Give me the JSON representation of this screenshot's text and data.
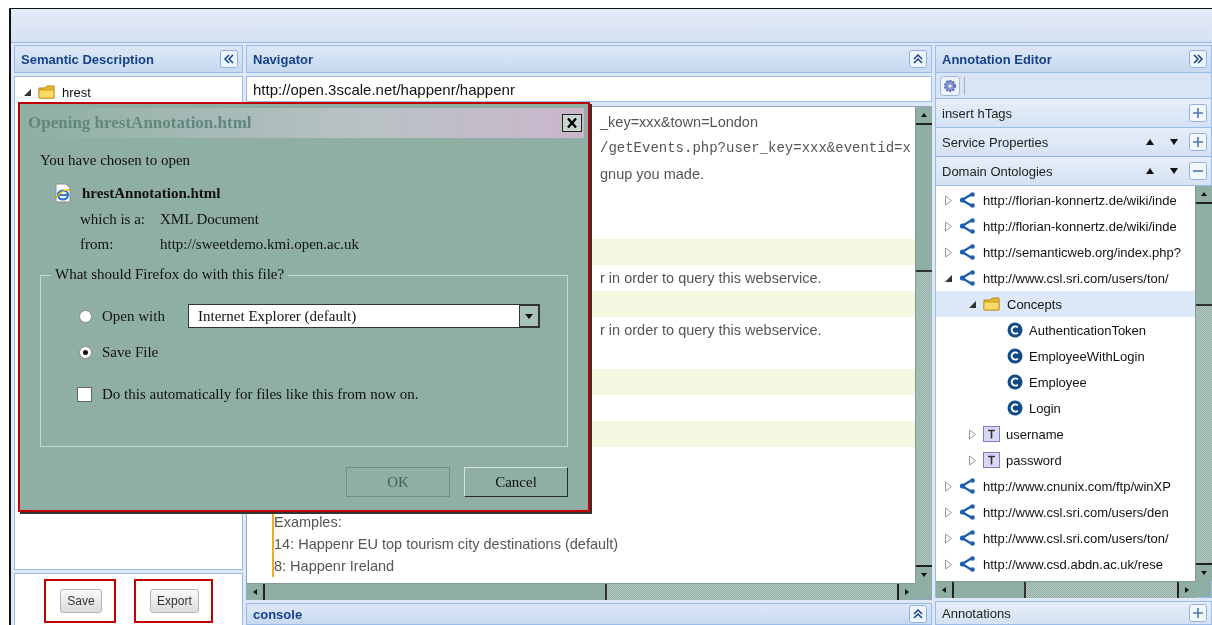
{
  "semantic_panel": {
    "title": "Semantic Description",
    "tree": [
      {
        "label": "hrest",
        "kind": "folder",
        "expanded": true,
        "selected": false
      }
    ],
    "buttons": [
      {
        "label": "Save",
        "highlighted": true
      },
      {
        "label": "Export",
        "highlighted": true
      }
    ]
  },
  "navigator": {
    "title": "Navigator",
    "url": "http://open.3scale.net/happenr/happenr",
    "rows": [
      {
        "text": "_key=xxx&town=London",
        "kind": "text",
        "highlighted": false,
        "quoted": false
      },
      {
        "text": "/getEvents.php?user_key=xxx&eventid=x",
        "kind": "code",
        "highlighted": false,
        "quoted": false
      },
      {
        "text": "gnup you made.",
        "kind": "text",
        "highlighted": false,
        "quoted": false
      },
      {
        "highlighted": false,
        "quoted": false
      },
      {
        "highlighted": false,
        "quoted": false
      },
      {
        "highlighted": true,
        "quoted": false
      },
      {
        "text": "r in order to query this webservice.",
        "kind": "text",
        "highlighted": false,
        "quoted": false
      },
      {
        "highlighted": true,
        "quoted": false
      },
      {
        "text": "r in order to query this webservice.",
        "kind": "text",
        "highlighted": false,
        "quoted": false
      },
      {
        "highlighted": false,
        "quoted": false
      },
      {
        "highlighted": true,
        "quoted": false
      },
      {
        "highlighted": false,
        "quoted": false
      },
      {
        "highlighted": true,
        "quoted": false
      },
      {
        "highlighted": false,
        "quoted": false
      },
      {
        "highlighted": false,
        "quoted": false
      },
      {
        "text": "Examples:",
        "kind": "text",
        "highlighted": false,
        "quoted": true
      },
      {
        "text": "14: Happenr EU top tourism city destinations (default)",
        "kind": "text",
        "highlighted": false,
        "quoted": true
      },
      {
        "text": "8: Happenr Ireland",
        "kind": "text",
        "highlighted": false,
        "quoted": true
      }
    ]
  },
  "console": {
    "title": "console"
  },
  "annotation_editor": {
    "title": "Annotation Editor",
    "sections": [
      {
        "title": "insert hTags",
        "expanded": false,
        "movable": false
      },
      {
        "title": "Service Properties",
        "expanded": false,
        "movable": true
      },
      {
        "title": "Domain Ontologies",
        "expanded": true,
        "movable": true
      }
    ],
    "tree": [
      {
        "label": "http://florian-konnertz.de/wiki/inde",
        "kind": "ontology",
        "expanded": false,
        "selected": false
      },
      {
        "label": "http://florian-konnertz.de/wiki/inde",
        "kind": "ontology",
        "expanded": false,
        "selected": false
      },
      {
        "label": "http://semanticweb.org/index.php?",
        "kind": "ontology",
        "expanded": false,
        "selected": false
      },
      {
        "label": "http://www.csl.sri.com/users/ton/",
        "kind": "ontology",
        "expanded": true,
        "selected": false,
        "children": [
          {
            "label": "Concepts",
            "kind": "folder",
            "expanded": true,
            "selected": true,
            "children": [
              {
                "label": "AuthenticationToken",
                "kind": "class",
                "selected": false
              },
              {
                "label": "EmployeeWithLogin",
                "kind": "class",
                "selected": false
              },
              {
                "label": "Employee",
                "kind": "class",
                "selected": false
              },
              {
                "label": "Login",
                "kind": "class",
                "selected": false
              }
            ]
          },
          {
            "label": "username",
            "kind": "type",
            "expanded": false,
            "selected": false
          },
          {
            "label": "password",
            "kind": "type",
            "expanded": false,
            "selected": false
          }
        ]
      },
      {
        "label": "http://www.cnunix.com/ftp/winXP",
        "kind": "ontology",
        "expanded": false,
        "selected": false
      },
      {
        "label": "http://www.csl.sri.com/users/den",
        "kind": "ontology",
        "expanded": false,
        "selected": false
      },
      {
        "label": "http://www.csl.sri.com/users/ton/",
        "kind": "ontology",
        "expanded": false,
        "selected": false
      },
      {
        "label": "http://www.csd.abdn.ac.uk/rese",
        "kind": "ontology",
        "expanded": false,
        "selected": false
      }
    ],
    "footer": {
      "title": "Annotations",
      "expanded": false
    }
  },
  "dialog": {
    "title": "Opening hrestAnnotation.html",
    "highlighted": true,
    "intro": "You have chosen to open",
    "file_name": "hrestAnnotation.html",
    "type_label": "which is a:",
    "type_value": "XML Document",
    "from_label": "from:",
    "from_value": "http://sweetdemo.kmi.open.ac.uk",
    "group_title": "What should Firefox do with this file?",
    "options": [
      {
        "label": "Open with",
        "selected": false
      },
      {
        "label": "Save File",
        "selected": true
      }
    ],
    "application": "Internet Explorer (default)",
    "remember": {
      "label": "Do this automatically for files like this from now on.",
      "checked": false
    },
    "buttons": [
      {
        "label": "OK",
        "disabled": true
      },
      {
        "label": "Cancel",
        "disabled": false
      }
    ]
  }
}
